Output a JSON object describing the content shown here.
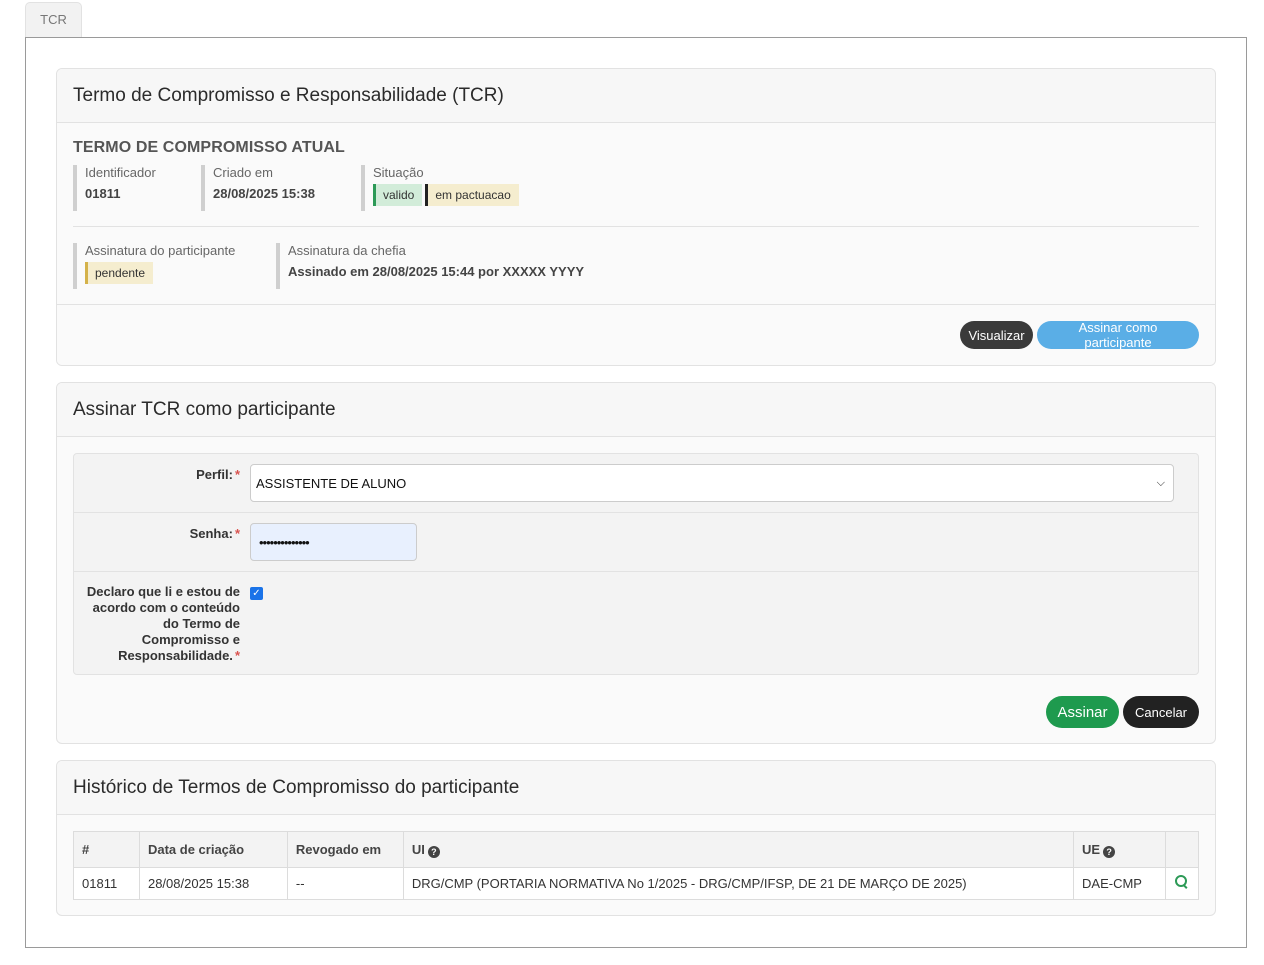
{
  "tabs": [
    {
      "label": "TCR"
    }
  ],
  "tcr_card": {
    "title": "Termo de Compromisso e Responsabilidade (TCR)",
    "section_title": "TERMO DE COMPROMISSO ATUAL",
    "identificador_label": "Identificador",
    "identificador_value": "01811",
    "criado_label": "Criado em",
    "criado_value": "28/08/2025 15:38",
    "situacao_label": "Situação",
    "situacao_badges": [
      "valido",
      "em pactuacao"
    ],
    "assinatura_participante_label": "Assinatura do participante",
    "assinatura_participante_value": "pendente",
    "assinatura_chefia_label": "Assinatura da chefia",
    "assinatura_chefia_value": "Assinado em 28/08/2025 15:44 por XXXXX YYYY",
    "visualizar_label": "Visualizar",
    "assinar_participante_label": "Assinar como participante"
  },
  "sign_card": {
    "title": "Assinar TCR como participante",
    "perfil_label": "Perfil:",
    "perfil_value": "ASSISTENTE DE ALUNO",
    "senha_label": "Senha:",
    "senha_value": "••••••••••••••",
    "declaro_label": "Declaro que li e estou de acordo com o conteúdo do Termo de Compromisso e Responsabilidade.",
    "declaro_checked": true,
    "required_mark": "*",
    "assinar_label": "Assinar",
    "cancelar_label": "Cancelar"
  },
  "history_card": {
    "title": "Histórico de Termos de Compromisso do participante",
    "columns": [
      "#",
      "Data de criação",
      "Revogado em",
      "UI",
      "UE",
      ""
    ],
    "rows": [
      {
        "id": "01811",
        "data_criacao": "28/08/2025 15:38",
        "revogado_em": "--",
        "ui": "DRG/CMP (PORTARIA NORMATIVA No 1/2025 - DRG/CMP/IFSP, DE 21 DE MARÇO DE 2025)",
        "ue": "DAE-CMP"
      }
    ]
  },
  "colors": {
    "success": "#1e9a4e",
    "primary_light": "#5aaee6",
    "dark": "#222222"
  }
}
